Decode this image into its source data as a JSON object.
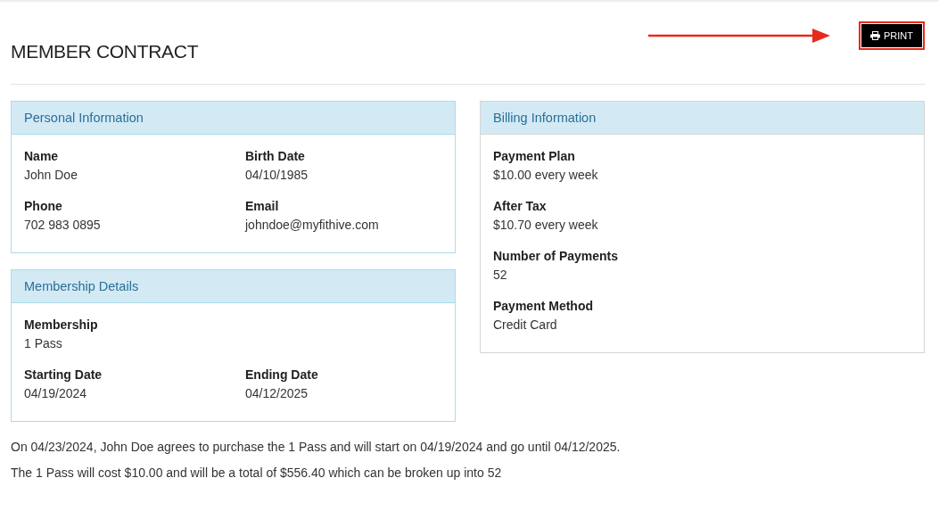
{
  "title": "MEMBER CONTRACT",
  "print_button": {
    "label": "PRINT"
  },
  "left_column": [
    {
      "heading": "Personal Information",
      "rows": [
        [
          {
            "label": "Name",
            "value": "John Doe"
          },
          {
            "label": "Birth Date",
            "value": "04/10/1985"
          }
        ],
        [
          {
            "label": "Phone",
            "value": "702 983 0895"
          },
          {
            "label": "Email",
            "value": "johndoe@myfithive.com"
          }
        ]
      ]
    },
    {
      "heading": "Membership Details",
      "rows": [
        [
          {
            "label": "Membership",
            "value": "1 Pass"
          }
        ],
        [
          {
            "label": "Starting Date",
            "value": "04/19/2024"
          },
          {
            "label": "Ending Date",
            "value": "04/12/2025"
          }
        ]
      ]
    }
  ],
  "right_column": [
    {
      "heading": "Billing Information",
      "rows": [
        [
          {
            "label": "Payment Plan",
            "value": "$10.00 every week"
          }
        ],
        [
          {
            "label": "After Tax",
            "value": "$10.70 every week"
          }
        ],
        [
          {
            "label": "Number of Payments",
            "value": "52"
          }
        ],
        [
          {
            "label": "Payment Method",
            "value": "Credit Card"
          }
        ]
      ]
    }
  ],
  "paragraphs": [
    "On 04/23/2024, John Doe agrees to purchase the 1 Pass and will start on 04/19/2024 and go until 04/12/2025.",
    "The 1 Pass will cost $10.00 and will be a total of $556.40 which can be broken up into 52"
  ]
}
